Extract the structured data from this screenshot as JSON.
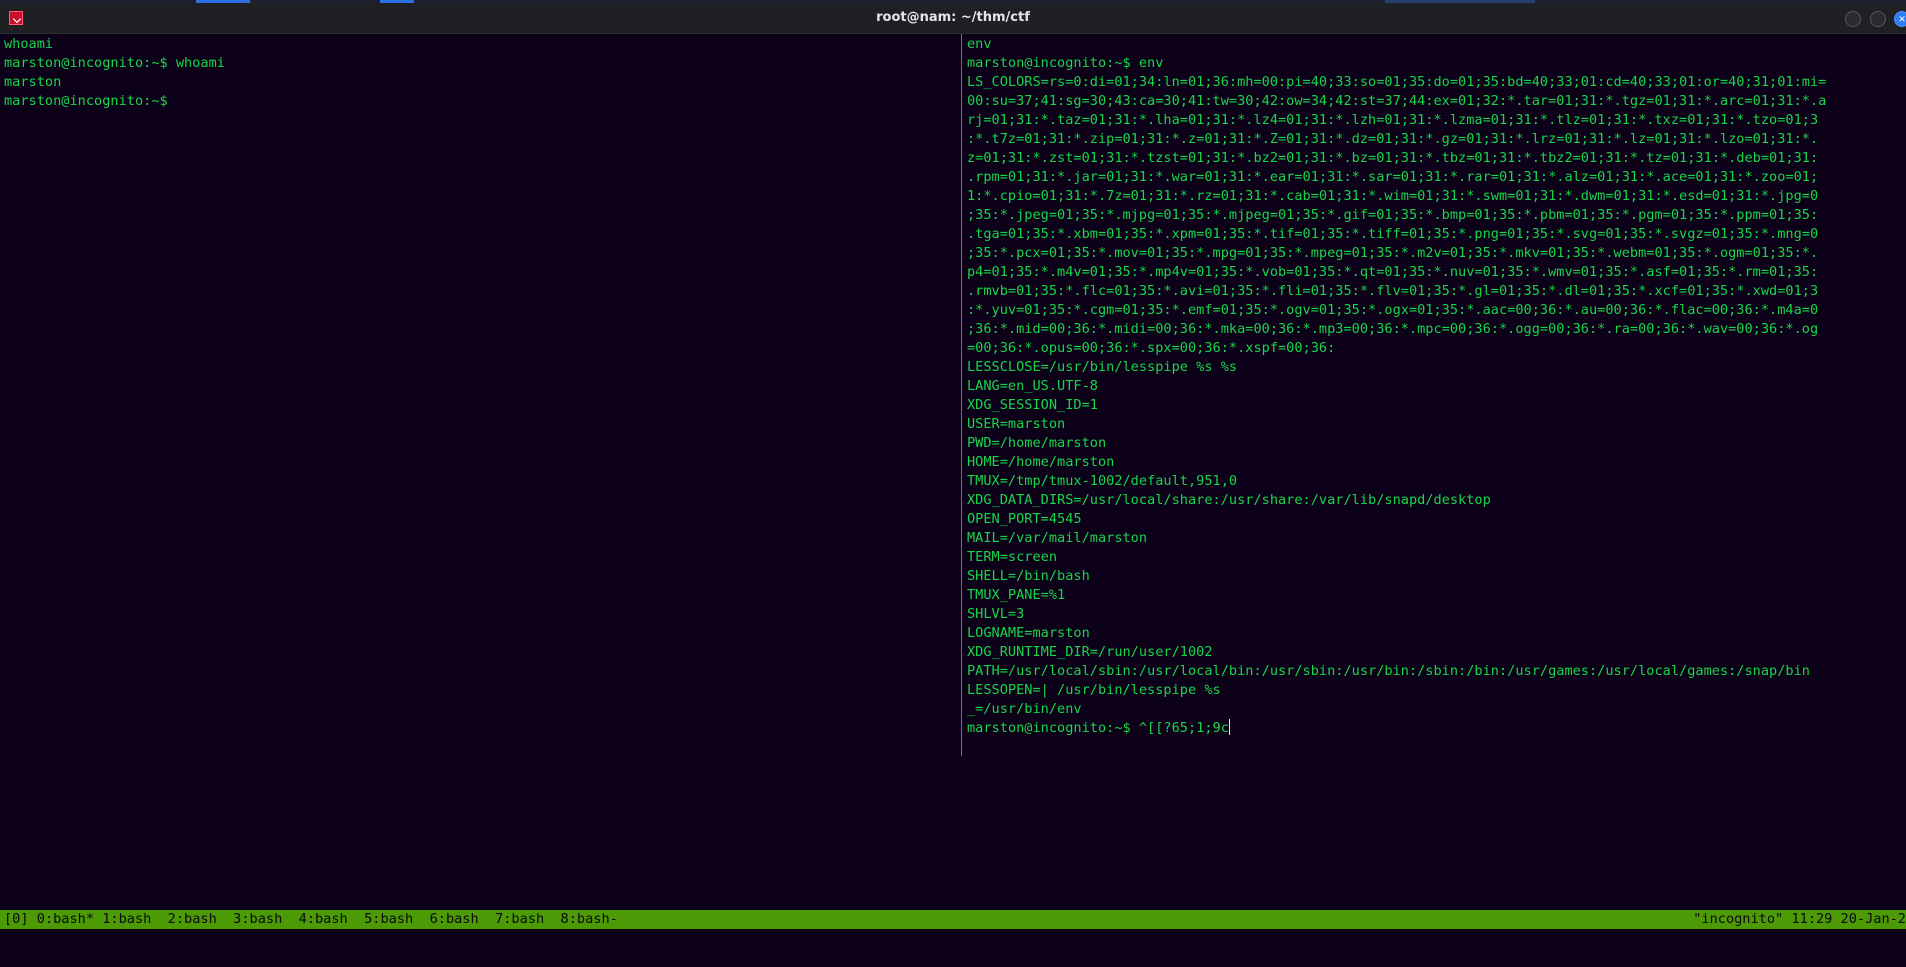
{
  "window": {
    "title": "root@nam: ~/thm/ctf",
    "accent": "#2f7cf6"
  },
  "colors": {
    "background": "#0c0118",
    "terminal_text": "#18d54a",
    "status_bar": "#4c9a06"
  },
  "left_pane": {
    "lines": [
      "whoami",
      "marston@incognito:~$ whoami",
      "marston",
      "marston@incognito:~$"
    ]
  },
  "right_pane": {
    "lines": [
      "env",
      "marston@incognito:~$ env",
      "LS_COLORS=rs=0:di=01;34:ln=01;36:mh=00:pi=40;33:so=01;35:do=01;35:bd=40;33;01:cd=40;33;01:or=40;31;01:mi=",
      "00:su=37;41:sg=30;43:ca=30;41:tw=30;42:ow=34;42:st=37;44:ex=01;32:*.tar=01;31:*.tgz=01;31:*.arc=01;31:*.a",
      "rj=01;31:*.taz=01;31:*.lha=01;31:*.lz4=01;31:*.lzh=01;31:*.lzma=01;31:*.tlz=01;31:*.txz=01;31:*.tzo=01;3",
      ":*.t7z=01;31:*.zip=01;31:*.z=01;31:*.Z=01;31:*.dz=01;31:*.gz=01;31:*.lrz=01;31:*.lz=01;31:*.lzo=01;31:*.",
      "z=01;31:*.zst=01;31:*.tzst=01;31:*.bz2=01;31:*.bz=01;31:*.tbz=01;31:*.tbz2=01;31:*.tz=01;31:*.deb=01;31:",
      ".rpm=01;31:*.jar=01;31:*.war=01;31:*.ear=01;31:*.sar=01;31:*.rar=01;31:*.alz=01;31:*.ace=01;31:*.zoo=01;",
      "1:*.cpio=01;31:*.7z=01;31:*.rz=01;31:*.cab=01;31:*.wim=01;31:*.swm=01;31:*.dwm=01;31:*.esd=01;31:*.jpg=0",
      ";35:*.jpeg=01;35:*.mjpg=01;35:*.mjpeg=01;35:*.gif=01;35:*.bmp=01;35:*.pbm=01;35:*.pgm=01;35:*.ppm=01;35:",
      ".tga=01;35:*.xbm=01;35:*.xpm=01;35:*.tif=01;35:*.tiff=01;35:*.png=01;35:*.svg=01;35:*.svgz=01;35:*.mng=0",
      ";35:*.pcx=01;35:*.mov=01;35:*.mpg=01;35:*.mpeg=01;35:*.m2v=01;35:*.mkv=01;35:*.webm=01;35:*.ogm=01;35:*.",
      "p4=01;35:*.m4v=01;35:*.mp4v=01;35:*.vob=01;35:*.qt=01;35:*.nuv=01;35:*.wmv=01;35:*.asf=01;35:*.rm=01;35:",
      ".rmvb=01;35:*.flc=01;35:*.avi=01;35:*.fli=01;35:*.flv=01;35:*.gl=01;35:*.dl=01;35:*.xcf=01;35:*.xwd=01;3",
      ":*.yuv=01;35:*.cgm=01;35:*.emf=01;35:*.ogv=01;35:*.ogx=01;35:*.aac=00;36:*.au=00;36:*.flac=00;36:*.m4a=0",
      ";36:*.mid=00;36:*.midi=00;36:*.mka=00;36:*.mp3=00;36:*.mpc=00;36:*.ogg=00;36:*.ra=00;36:*.wav=00;36:*.og",
      "=00;36:*.opus=00;36:*.spx=00;36:*.xspf=00;36:",
      "LESSCLOSE=/usr/bin/lesspipe %s %s",
      "LANG=en_US.UTF-8",
      "XDG_SESSION_ID=1",
      "USER=marston",
      "PWD=/home/marston",
      "HOME=/home/marston",
      "TMUX=/tmp/tmux-1002/default,951,0",
      "XDG_DATA_DIRS=/usr/local/share:/usr/share:/var/lib/snapd/desktop",
      "OPEN_PORT=4545",
      "MAIL=/var/mail/marston",
      "TERM=screen",
      "SHELL=/bin/bash",
      "TMUX_PANE=%1",
      "SHLVL=3",
      "LOGNAME=marston",
      "XDG_RUNTIME_DIR=/run/user/1002",
      "PATH=/usr/local/sbin:/usr/local/bin:/usr/sbin:/usr/bin:/sbin:/bin:/usr/games:/usr/local/games:/snap/bin",
      "LESSOPEN=| /usr/bin/lesspipe %s",
      "_=/usr/bin/env"
    ],
    "prompt_line": "marston@incognito:~$ ^[[?65;1;9c"
  },
  "status_bar": {
    "left": "[0] 0:bash* 1:bash  2:bash  3:bash  4:bash  5:bash  6:bash  7:bash  8:bash-",
    "right": "\"incognito\" 11:29 20-Jan-2"
  }
}
